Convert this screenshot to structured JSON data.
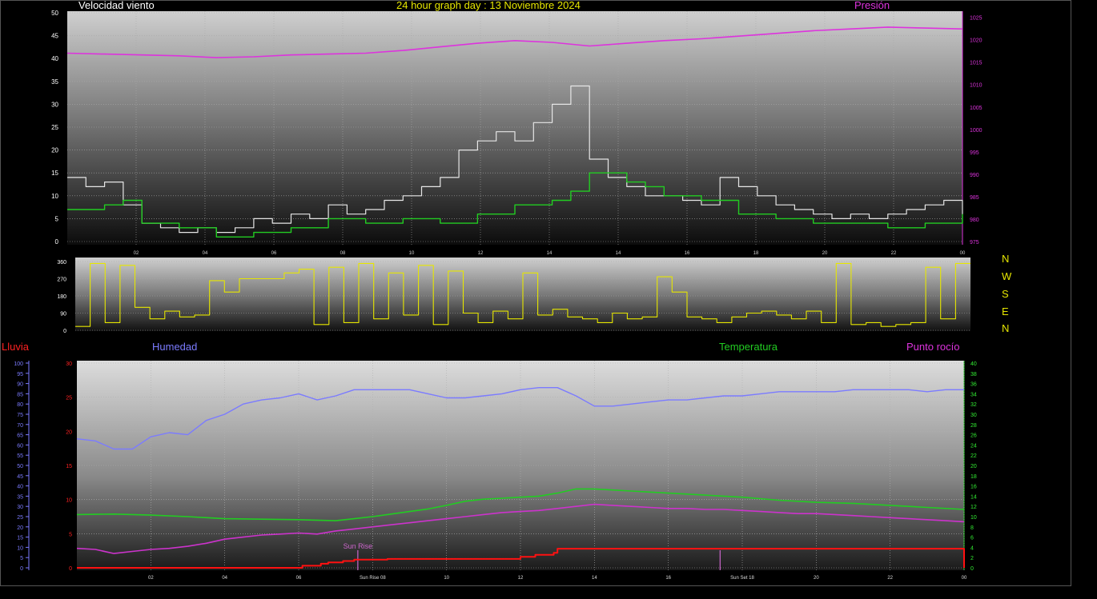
{
  "header": {
    "left_title": "Velocidad viento",
    "center_title": "24 hour graph day : 13 Noviembre 2024",
    "right_title": "Presión"
  },
  "lower_header": {
    "rain": "Lluvia",
    "humidity": "Humedad",
    "temperature": "Temperatura",
    "dew_point": "Punto rocío"
  },
  "compass": [
    "N",
    "W",
    "S",
    "E",
    "N"
  ],
  "colors": {
    "wind": "#e6e6e6",
    "avg_wind": "#22cc22",
    "pressure": "#dd33dd",
    "direction": "#e6e600",
    "humidity": "#7b7bff",
    "temperature": "#22cc22",
    "dew_point": "#cc33cc",
    "rain": "#ff1111",
    "sun": "#cc66cc"
  },
  "chart_data": [
    {
      "type": "line",
      "name": "wind-pressure",
      "title": "Velocidad viento",
      "x_ticks": [
        "02",
        "04",
        "06",
        "08",
        "10",
        "12",
        "14",
        "14",
        "16",
        "18",
        "20",
        "22",
        "00"
      ],
      "xlim": [
        0,
        24
      ],
      "ylim": [
        0,
        50
      ],
      "yticks": [
        0,
        5,
        10,
        15,
        20,
        25,
        30,
        35,
        40,
        45,
        50
      ],
      "y2lim": [
        975,
        1026
      ],
      "y2ticks": [
        975,
        980,
        985,
        990,
        995,
        1000,
        1005,
        1010,
        1015,
        1020,
        1025
      ],
      "series": [
        {
          "role": "wind_gust",
          "x": [
            0,
            0.5,
            1,
            1.5,
            2,
            2.5,
            3,
            3.5,
            4,
            4.5,
            5,
            5.5,
            6,
            6.5,
            7,
            7.5,
            8,
            8.5,
            9,
            9.5,
            10,
            10.5,
            11,
            11.5,
            12,
            12.5,
            13,
            13.5,
            14,
            14.5,
            15,
            15.5,
            16,
            16.5,
            17,
            17.5,
            18,
            18.5,
            19,
            19.5,
            20,
            20.5,
            21,
            21.5,
            22,
            22.5,
            23,
            23.5,
            24
          ],
          "values": [
            14,
            12,
            13,
            8,
            4,
            3,
            2,
            3,
            2,
            3,
            5,
            4,
            6,
            5,
            8,
            6,
            7,
            9,
            10,
            12,
            14,
            20,
            22,
            24,
            22,
            26,
            30,
            34,
            18,
            14,
            12,
            10,
            10,
            9,
            8,
            14,
            12,
            10,
            8,
            7,
            6,
            5,
            6,
            5,
            6,
            7,
            8,
            9,
            6
          ]
        },
        {
          "role": "wind_avg",
          "x": [
            0,
            1,
            1.5,
            2,
            3,
            4,
            5,
            6,
            7,
            8,
            9,
            10,
            11,
            12,
            13,
            13.5,
            14,
            15,
            15.5,
            16,
            17,
            18,
            19,
            20,
            21,
            22,
            23,
            24
          ],
          "values": [
            7,
            8,
            9,
            4,
            3,
            1,
            2,
            3,
            5,
            4,
            5,
            4,
            6,
            8,
            9,
            11,
            15,
            13,
            12,
            10,
            9,
            6,
            5,
            4,
            4,
            3,
            4,
            6
          ]
        },
        {
          "role": "pressure",
          "axis": "y2",
          "x": [
            0,
            1,
            2,
            3,
            4,
            5,
            6,
            7,
            8,
            9,
            10,
            11,
            12,
            13,
            14,
            15,
            16,
            17,
            18,
            19,
            20,
            21,
            22,
            23,
            24
          ],
          "values": [
            1017,
            1016.8,
            1016.6,
            1016.4,
            1016,
            1016.2,
            1016.6,
            1016.8,
            1017,
            1017.6,
            1018.4,
            1019.2,
            1019.8,
            1019.4,
            1018.6,
            1019.2,
            1019.8,
            1020.2,
            1020.8,
            1021.4,
            1022,
            1022.4,
            1022.8,
            1022.6,
            1022.4
          ]
        }
      ]
    },
    {
      "type": "line",
      "name": "wind-direction",
      "ylim": [
        0,
        360
      ],
      "yticks": [
        0,
        90,
        180,
        270,
        360
      ],
      "series": [
        {
          "role": "direction",
          "x": [
            0,
            0.4,
            0.8,
            1.2,
            1.6,
            2,
            2.4,
            2.8,
            3.2,
            3.6,
            4,
            4.4,
            4.8,
            5.2,
            5.6,
            6,
            6.4,
            6.8,
            7.2,
            7.6,
            8,
            8.4,
            8.8,
            9.2,
            9.6,
            10,
            10.4,
            10.8,
            11.2,
            11.6,
            12,
            12.4,
            12.8,
            13.2,
            13.6,
            14,
            14.4,
            14.8,
            15.2,
            15.6,
            16,
            16.4,
            16.8,
            17.2,
            17.6,
            18,
            18.4,
            18.8,
            19.2,
            19.6,
            20,
            20.4,
            20.8,
            21.2,
            21.6,
            22,
            22.4,
            22.8,
            23.2,
            23.6,
            24
          ],
          "values": [
            20,
            350,
            40,
            340,
            120,
            60,
            100,
            70,
            80,
            260,
            200,
            270,
            270,
            270,
            300,
            320,
            30,
            330,
            40,
            350,
            60,
            300,
            80,
            340,
            30,
            310,
            90,
            40,
            100,
            60,
            300,
            80,
            110,
            70,
            60,
            40,
            90,
            60,
            70,
            280,
            200,
            70,
            60,
            40,
            70,
            90,
            100,
            80,
            60,
            100,
            40,
            350,
            30,
            40,
            20,
            30,
            40,
            330,
            60,
            350,
            350
          ]
        }
      ]
    },
    {
      "type": "line",
      "name": "humidity-temperature",
      "x_ticks": [
        "02",
        "04",
        "06",
        "Sun Rise 08",
        "10",
        "12",
        "14",
        "16",
        "Sun Set 18",
        "20",
        "22",
        "00"
      ],
      "xlim": [
        0,
        24
      ],
      "rain_ylim": [
        0,
        30
      ],
      "rain_yticks": [
        0,
        5,
        10,
        15,
        20,
        25,
        30
      ],
      "humidity_ylim": [
        0,
        100
      ],
      "humidity_yticks": [
        0,
        5,
        10,
        15,
        20,
        25,
        30,
        35,
        40,
        45,
        50,
        55,
        60,
        65,
        70,
        75,
        80,
        85,
        90,
        95,
        100
      ],
      "temp_ylim": [
        0,
        40
      ],
      "temp_yticks": [
        0,
        2,
        4,
        6,
        8,
        10,
        12,
        14,
        16,
        18,
        20,
        22,
        24,
        26,
        28,
        30,
        32,
        34,
        36,
        38,
        40
      ],
      "annotations": [
        {
          "label": "Sun Rise",
          "x": 7.6
        },
        {
          "label": "Sun Set",
          "x": 17.4
        }
      ],
      "series": [
        {
          "role": "humidity",
          "axis": "humidity",
          "x": [
            0,
            0.5,
            1,
            1.5,
            2,
            2.5,
            3,
            3.5,
            4,
            4.5,
            5,
            5.5,
            6,
            6.5,
            7,
            7.5,
            8,
            8.5,
            9,
            9.5,
            10,
            10.5,
            11,
            11.5,
            12,
            12.5,
            13,
            13.5,
            14,
            14.5,
            15,
            15.5,
            16,
            16.5,
            17,
            17.5,
            18,
            18.5,
            19,
            19.5,
            20,
            20.5,
            21,
            21.5,
            22,
            22.5,
            23,
            23.5,
            24
          ],
          "values": [
            63,
            62,
            58,
            58,
            64,
            66,
            65,
            72,
            75,
            80,
            82,
            83,
            85,
            82,
            84,
            87,
            87,
            87,
            87,
            85,
            83,
            83,
            84,
            85,
            87,
            88,
            88,
            84,
            79,
            79,
            80,
            81,
            82,
            82,
            83,
            84,
            84,
            85,
            86,
            86,
            86,
            86,
            87,
            87,
            87,
            87,
            86,
            87,
            87
          ]
        },
        {
          "role": "temperature",
          "axis": "temp",
          "x": [
            0,
            1,
            2,
            3,
            4,
            5,
            6,
            7,
            7.5,
            8,
            8.5,
            9,
            9.5,
            10,
            10.5,
            11,
            11.5,
            12,
            12.5,
            13,
            13.5,
            14,
            14.5,
            15,
            15.5,
            16,
            16.5,
            17,
            17.5,
            18,
            19,
            20,
            21,
            22,
            23,
            24
          ],
          "values": [
            10.4,
            10.5,
            10.3,
            10.0,
            9.6,
            9.5,
            9.4,
            9.2,
            9.6,
            10.0,
            10.5,
            11.0,
            11.5,
            12.2,
            13.0,
            13.4,
            13.6,
            13.8,
            14.0,
            14.6,
            15.4,
            15.4,
            15.2,
            15.0,
            14.8,
            14.6,
            14.4,
            14.2,
            14.0,
            13.8,
            13.2,
            12.8,
            12.6,
            12.2,
            11.8,
            11.4
          ]
        },
        {
          "role": "dew_point",
          "axis": "temp",
          "x": [
            0,
            0.5,
            1,
            1.5,
            2,
            2.5,
            3,
            3.5,
            4,
            4.5,
            5,
            5.5,
            6,
            6.5,
            7,
            7.5,
            8,
            8.5,
            9,
            9.5,
            10,
            10.5,
            11,
            11.5,
            12,
            12.5,
            13,
            13.5,
            14,
            14.5,
            15,
            15.5,
            16,
            16.5,
            17,
            17.5,
            18,
            18.5,
            19,
            19.5,
            20,
            20.5,
            21,
            21.5,
            22,
            22.5,
            23,
            23.5,
            24
          ],
          "values": [
            3.8,
            3.6,
            2.8,
            3.2,
            3.6,
            3.8,
            4.2,
            4.8,
            5.6,
            6.0,
            6.4,
            6.6,
            6.8,
            6.6,
            7.2,
            7.6,
            8.0,
            8.4,
            8.8,
            9.2,
            9.6,
            10.0,
            10.4,
            10.8,
            11.0,
            11.2,
            11.6,
            12.0,
            12.4,
            12.2,
            12.0,
            11.8,
            11.6,
            11.6,
            11.4,
            11.4,
            11.2,
            11.0,
            10.8,
            10.6,
            10.6,
            10.4,
            10.2,
            10.0,
            9.8,
            9.6,
            9.4,
            9.2,
            9.0
          ]
        },
        {
          "role": "rain",
          "axis": "rain",
          "x": [
            0,
            5.8,
            6.1,
            6.6,
            6.8,
            7.2,
            7.5,
            8.4,
            12.0,
            12.4,
            12.9,
            13.0,
            14,
            16,
            18,
            20,
            22,
            23.9,
            24
          ],
          "values": [
            0,
            0,
            0.3,
            0.6,
            0.8,
            1.0,
            1.2,
            1.3,
            1.6,
            1.9,
            2.2,
            2.8,
            2.8,
            2.8,
            2.8,
            2.8,
            2.8,
            2.8,
            0
          ]
        }
      ]
    }
  ]
}
